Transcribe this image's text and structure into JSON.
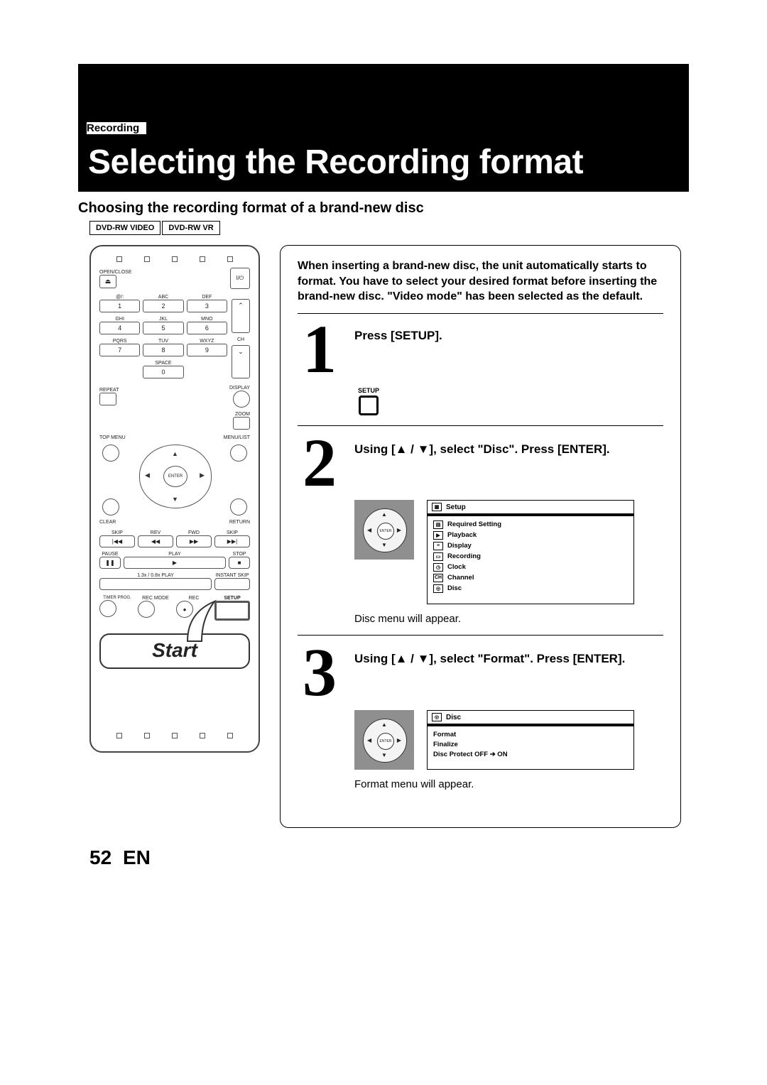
{
  "section_label": "Recording",
  "page_title": "Selecting the Recording format",
  "subheading": "Choosing the recording format of a brand-new disc",
  "badges": [
    "DVD-RW VIDEO",
    "DVD-RW VR"
  ],
  "intro_text": "When inserting a brand-new disc, the unit automatically starts to format. You have to select your desired format before inserting the brand-new disc. \"Video mode\" has been selected as the default.",
  "steps": [
    {
      "num": "1",
      "heading": "Press [SETUP].",
      "setup_label": "SETUP"
    },
    {
      "num": "2",
      "heading": "Using [▲ / ▼], select \"Disc\". Press [ENTER].",
      "caption": "Disc menu will appear.",
      "menu_title": "Setup",
      "menu_items": [
        "Required Setting",
        "Playback",
        "Display",
        "Recording",
        "Clock",
        "Channel",
        "Disc"
      ]
    },
    {
      "num": "3",
      "heading": "Using [▲ / ▼], select \"Format\". Press [ENTER].",
      "caption": "Format menu will appear.",
      "menu_title": "Disc",
      "menu_items": [
        "Format",
        "Finalize",
        "Disc Protect OFF ➔ ON"
      ]
    }
  ],
  "remote": {
    "open_close": "OPEN/CLOSE",
    "power": "I/⏻",
    "alpha_labels": [
      "@/:",
      "ABC",
      "DEF",
      "GHI",
      "JKL",
      "MNO",
      "PQRS",
      "TUV",
      "WXYZ",
      "",
      "SPACE",
      ""
    ],
    "num_labels": [
      "1",
      "2",
      "3",
      "4",
      "5",
      "6",
      "7",
      "8",
      "9",
      "",
      "0",
      ""
    ],
    "ch_label": "CH",
    "display": "DISPLAY",
    "repeat": "REPEAT",
    "zoom": "ZOOM",
    "top_menu": "TOP MENU",
    "menu_list": "MENU/LIST",
    "enter": "ENTER",
    "clear": "CLEAR",
    "return": "RETURN",
    "transport_labels": [
      "SKIP",
      "REV",
      "FWD",
      "SKIP"
    ],
    "transport_icons": [
      "|◀◀",
      "◀◀",
      "▶▶",
      "▶▶|"
    ],
    "pause": "PAUSE",
    "play": "PLAY",
    "stop": "STOP",
    "trick": "1.3x / 0.8x PLAY",
    "instant_skip": "INSTANT SKIP",
    "timer_prog": "TIMER PROG.",
    "rec_mode": "REC MODE",
    "rec": "REC",
    "setup": "SETUP",
    "start": "Start"
  },
  "dpad_center": "ENTER",
  "footer": {
    "page_num": "52",
    "lang": "EN"
  }
}
